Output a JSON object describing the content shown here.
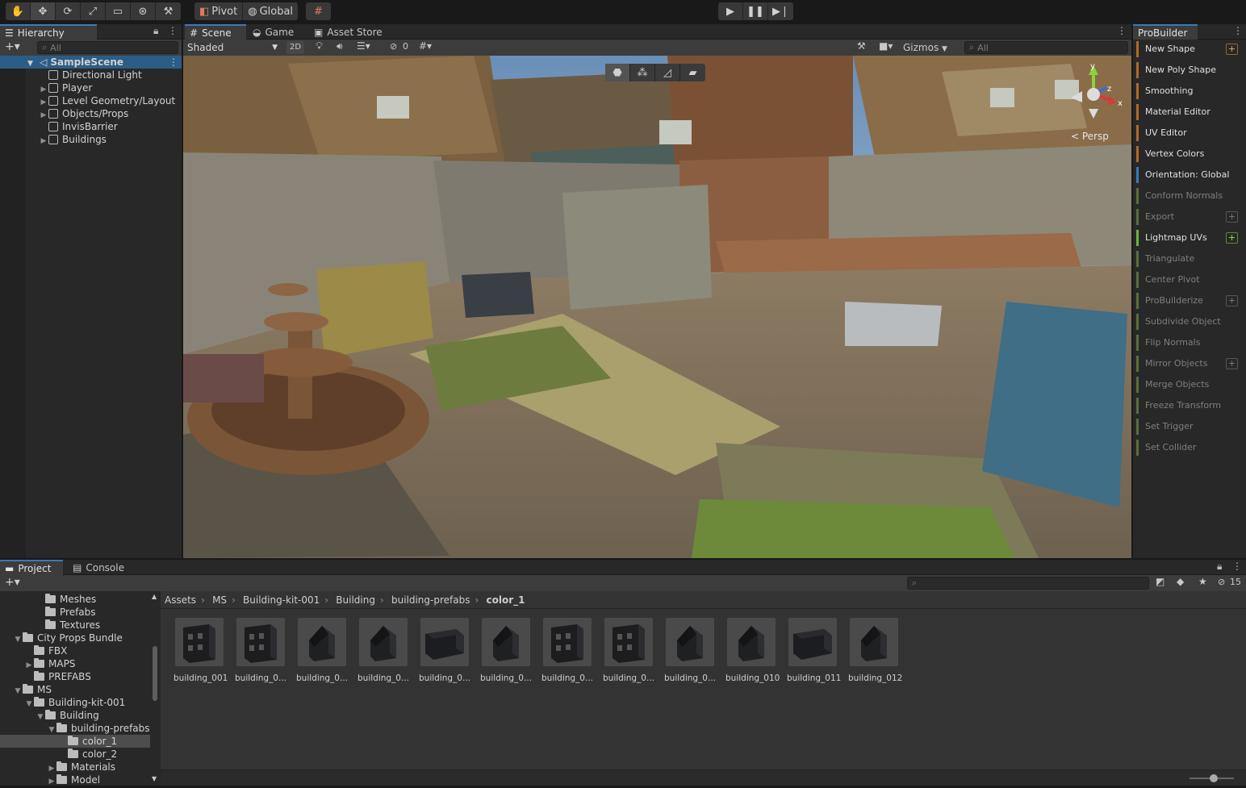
{
  "toolbar": {
    "pivot_label": "Pivot",
    "global_label": "Global"
  },
  "hierarchy": {
    "tab_label": "Hierarchy",
    "search_placeholder": "All",
    "scene_name": "SampleScene",
    "items": [
      {
        "label": "Directional Light",
        "expandable": false
      },
      {
        "label": "Player",
        "expandable": true
      },
      {
        "label": "Level Geometry/Layout",
        "expandable": true
      },
      {
        "label": "Objects/Props",
        "expandable": true
      },
      {
        "label": "InvisBarrier",
        "expandable": false
      },
      {
        "label": "Buildings",
        "expandable": true
      }
    ]
  },
  "scene_view": {
    "tabs": [
      "Scene",
      "Game",
      "Asset Store"
    ],
    "shading_mode": "Shaded",
    "toggle_2d": "2D",
    "hidden_count": "0",
    "gizmos_label": "Gizmos",
    "search_placeholder": "All",
    "camera_mode": "< Persp",
    "axis_labels": {
      "y": "y",
      "x": "x",
      "z": "z"
    }
  },
  "probuilder": {
    "tab_label": "ProBuilder",
    "items": [
      {
        "label": "New Shape",
        "style": "orange",
        "plus": "orange"
      },
      {
        "label": "New Poly Shape",
        "style": "orange"
      },
      {
        "label": "Smoothing",
        "style": "orange"
      },
      {
        "label": "Material Editor",
        "style": "orange"
      },
      {
        "label": "UV Editor",
        "style": "orange"
      },
      {
        "label": "Vertex Colors",
        "style": "orange"
      },
      {
        "label": "Orientation: Global",
        "style": "blue"
      },
      {
        "label": "Conform Normals",
        "style": "dim"
      },
      {
        "label": "Export",
        "style": "dim",
        "plus": "dim"
      },
      {
        "label": "Lightmap UVs",
        "style": "green",
        "plus": "green"
      },
      {
        "label": "Triangulate",
        "style": "dim"
      },
      {
        "label": "Center Pivot",
        "style": "dim"
      },
      {
        "label": "ProBuilderize",
        "style": "dim",
        "plus": "dim"
      },
      {
        "label": "Subdivide Object",
        "style": "dim"
      },
      {
        "label": "Flip Normals",
        "style": "dim"
      },
      {
        "label": "Mirror Objects",
        "style": "dim",
        "plus": "dim"
      },
      {
        "label": "Merge Objects",
        "style": "dim"
      },
      {
        "label": "Freeze Transform",
        "style": "dim"
      },
      {
        "label": "Set Trigger",
        "style": "dim"
      },
      {
        "label": "Set Collider",
        "style": "dim"
      }
    ]
  },
  "project": {
    "tabs": [
      "Project",
      "Console"
    ],
    "hidden_count": "15",
    "tree": [
      {
        "label": "Meshes",
        "indent": 3,
        "arrow": ""
      },
      {
        "label": "Prefabs",
        "indent": 3,
        "arrow": ""
      },
      {
        "label": "Textures",
        "indent": 3,
        "arrow": ""
      },
      {
        "label": "City Props Bundle",
        "indent": 1,
        "arrow": "▼"
      },
      {
        "label": "FBX",
        "indent": 2,
        "arrow": ""
      },
      {
        "label": "MAPS",
        "indent": 2,
        "arrow": "▶"
      },
      {
        "label": "PREFABS",
        "indent": 2,
        "arrow": ""
      },
      {
        "label": "MS",
        "indent": 1,
        "arrow": "▼"
      },
      {
        "label": "Building-kit-001",
        "indent": 2,
        "arrow": "▼"
      },
      {
        "label": "Building",
        "indent": 3,
        "arrow": "▼"
      },
      {
        "label": "building-prefabs",
        "indent": 4,
        "arrow": "▼"
      },
      {
        "label": "color_1",
        "indent": 5,
        "arrow": "",
        "selected": true
      },
      {
        "label": "color_2",
        "indent": 5,
        "arrow": ""
      },
      {
        "label": "Materials",
        "indent": 4,
        "arrow": "▶"
      },
      {
        "label": "Model",
        "indent": 4,
        "arrow": "▶"
      }
    ],
    "breadcrumb": [
      "Assets",
      "MS",
      "Building-kit-001",
      "Building",
      "building-prefabs",
      "color_1"
    ],
    "assets": [
      {
        "label": "building_001",
        "variant": 1
      },
      {
        "label": "building_0...",
        "variant": 1
      },
      {
        "label": "building_0...",
        "variant": 2
      },
      {
        "label": "building_0...",
        "variant": 2
      },
      {
        "label": "building_0...",
        "variant": 3
      },
      {
        "label": "building_0...",
        "variant": 2
      },
      {
        "label": "building_0...",
        "variant": 1
      },
      {
        "label": "building_0...",
        "variant": 1
      },
      {
        "label": "building_0...",
        "variant": 2
      },
      {
        "label": "building_010",
        "variant": 2
      },
      {
        "label": "building_011",
        "variant": 3
      },
      {
        "label": "building_012",
        "variant": 2
      }
    ]
  }
}
